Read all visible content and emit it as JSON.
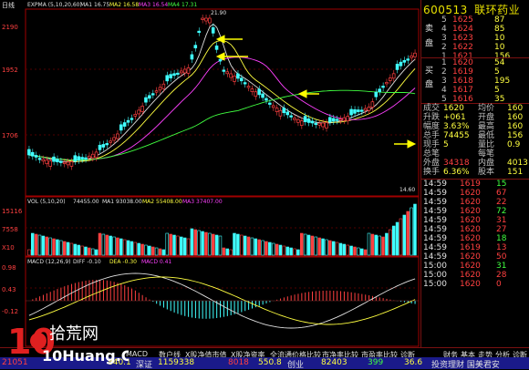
{
  "chart_header": {
    "indicator": "EXPMA (5,10,20,60)",
    "ma_labels": [
      {
        "name": "MA1",
        "value": "16.75",
        "color": "#e0e0e0"
      },
      {
        "name": "MA2",
        "value": "16.58",
        "color": "#ffff40"
      },
      {
        "name": "MA3",
        "value": "16.54",
        "color": "#ff40ff"
      },
      {
        "name": "MA4",
        "value": "17.31",
        "color": "#40ff40"
      }
    ],
    "period_label": "日线"
  },
  "price_axis": [
    "2190",
    "1952",
    "1706"
  ],
  "price_annotations": {
    "high": "21.90",
    "low": "14.60"
  },
  "volume_header": {
    "title": "VOL (5,10,20)",
    "value": "74455.00",
    "ma1": "MA1 93038.00",
    "ma2": "MA2 55408.00",
    "ma3": "MA3 37407.00"
  },
  "volume_axis": [
    "15116",
    "7558",
    "X10"
  ],
  "macd_header": {
    "title": "MACD (12,26,9)",
    "diff": "DIFF -0.10",
    "dea": "DEA -0.30",
    "macd": "MACD 0.41"
  },
  "macd_axis": [
    "0.98",
    "0.43",
    "-0.12"
  ],
  "stock": {
    "code": "600513",
    "name": "联环药业"
  },
  "order_book": {
    "sell_label": "卖",
    "sell_label2": "盘",
    "buy_label": "买",
    "buy_label2": "盘",
    "asks": [
      {
        "level": "5",
        "price": "1625",
        "vol": "87"
      },
      {
        "level": "4",
        "price": "1624",
        "vol": "85"
      },
      {
        "level": "3",
        "price": "1623",
        "vol": "10"
      },
      {
        "level": "2",
        "price": "1622",
        "vol": "10"
      },
      {
        "level": "1",
        "price": "1621",
        "vol": "156"
      }
    ],
    "bids": [
      {
        "level": "1",
        "price": "1620",
        "vol": "54"
      },
      {
        "level": "2",
        "price": "1619",
        "vol": "5"
      },
      {
        "level": "3",
        "price": "1618",
        "vol": "195"
      },
      {
        "level": "4",
        "price": "1617",
        "vol": "5"
      },
      {
        "level": "5",
        "price": "1616",
        "vol": "35"
      }
    ]
  },
  "quote_stats": [
    {
      "label": "成交",
      "value": "1620",
      "label2": "均价",
      "value2": "160"
    },
    {
      "label": "升跌",
      "value": "+061",
      "label2": "开盘",
      "value2": "160"
    },
    {
      "label": "幅度",
      "value": "3.63%",
      "label2": "最高",
      "value2": "160"
    },
    {
      "label": "总手",
      "value": "74455",
      "label2": "最低",
      "value2": "156"
    },
    {
      "label": "现手",
      "value": "5",
      "label2": "量比",
      "value2": "0.9"
    },
    {
      "label": "总笔",
      "value": "",
      "label2": "每笔",
      "value2": ""
    },
    {
      "label": "外盘",
      "value": "34318",
      "label2": "内盘",
      "value2": "4013"
    },
    {
      "label": "换手",
      "value": "6.36%",
      "label2": "股本",
      "value2": "151"
    }
  ],
  "trades": [
    {
      "time": "14:59",
      "price": "1619",
      "vol": "15"
    },
    {
      "time": "14:59",
      "price": "1620",
      "vol": "67"
    },
    {
      "time": "14:59",
      "price": "1620",
      "vol": "22"
    },
    {
      "time": "14:59",
      "price": "1620",
      "vol": "72"
    },
    {
      "time": "14:59",
      "price": "1620",
      "vol": "31"
    },
    {
      "time": "14:59",
      "price": "1620",
      "vol": "27"
    },
    {
      "time": "14:59",
      "price": "1620",
      "vol": "18"
    },
    {
      "time": "14:59",
      "price": "1619",
      "vol": "13"
    },
    {
      "time": "14:59",
      "price": "1620",
      "vol": "50"
    },
    {
      "time": "15:00",
      "price": "1620",
      "vol": "31"
    },
    {
      "time": "15:00",
      "price": "1620",
      "vol": "28"
    },
    {
      "time": "15:00",
      "price": "1620",
      "vol": "0"
    }
  ],
  "bottom_tabs": [
    "MACD",
    "数户线",
    "X股净值市值",
    "X股净资率",
    "全流通价格比较",
    "市净率比较",
    "市盈率比较",
    "诊断"
  ],
  "right_tabs": [
    "财务",
    "基本",
    "走势",
    "分析",
    "诊断"
  ],
  "status": {
    "index1": "21051",
    "index1_change": "840.1",
    "index2_name": "深证",
    "index2_vol": "1159338",
    "index3": "8018",
    "index3_change": "550.8",
    "index3_name": "创业",
    "index4": "82403",
    "index5": "399",
    "index6": "36.6",
    "right_text": "投资理财 国美君安"
  },
  "watermark": {
    "site": "拾荒网",
    "domain": "10Huang.CN"
  },
  "colors": {
    "up": "#ff4040",
    "down": "#40ffff",
    "axis": "#a00000"
  }
}
